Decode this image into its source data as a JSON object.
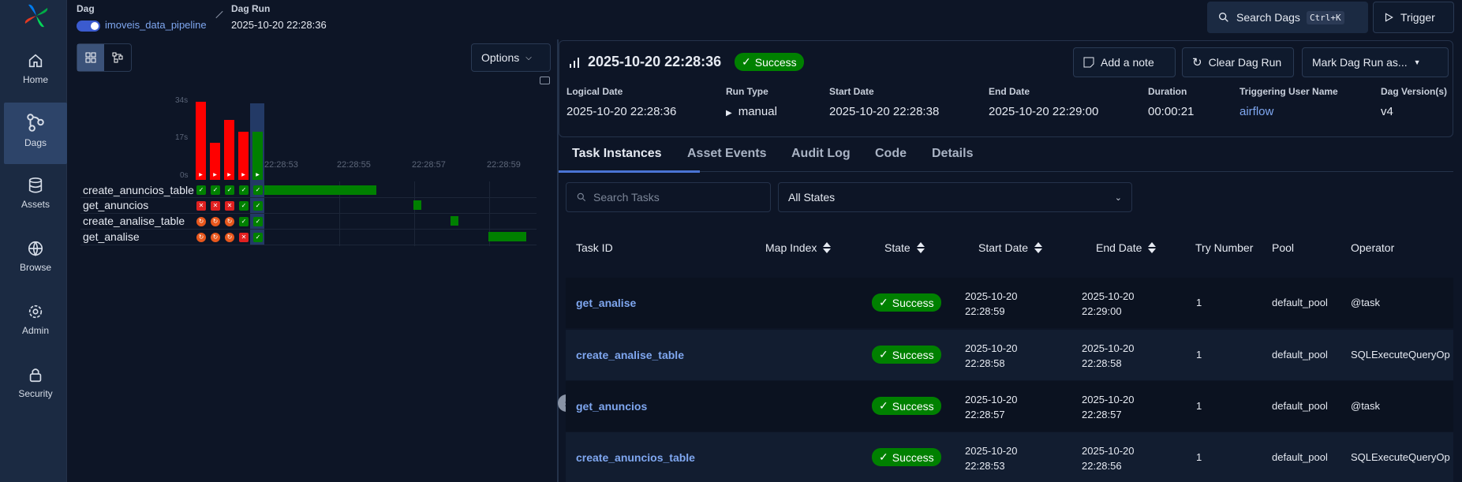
{
  "sidebar": {
    "items": [
      {
        "label": "Home",
        "icon": "home-icon"
      },
      {
        "label": "Dags",
        "icon": "dags-icon",
        "active": true
      },
      {
        "label": "Assets",
        "icon": "database-icon"
      },
      {
        "label": "Browse",
        "icon": "globe-icon"
      },
      {
        "label": "Admin",
        "icon": "gear-icon"
      },
      {
        "label": "Security",
        "icon": "lock-icon"
      }
    ]
  },
  "header": {
    "dag_label": "Dag",
    "dag_name": "imoveis_data_pipeline",
    "dagrun_label": "Dag Run",
    "dagrun_value": "2025-10-20 22:28:36",
    "search_label": "Search Dags",
    "search_kbd": "Ctrl+K",
    "trigger_label": "Trigger"
  },
  "graph": {
    "options_label": "Options",
    "y_ticks": [
      "34s",
      "17s",
      "0s"
    ],
    "time_ticks": [
      "22:28:53",
      "22:28:55",
      "22:28:57",
      "22:28:59"
    ],
    "durations_s": [
      34,
      16,
      26,
      21,
      21
    ],
    "tasks": [
      "create_anuncios_table",
      "get_anuncios",
      "create_analise_table",
      "get_analise"
    ],
    "colors": {
      "success": "#008000",
      "failed": "#ff0000",
      "upstream_failed": "#e8571c"
    }
  },
  "run": {
    "title": "2025-10-20 22:28:36",
    "status": "Success",
    "add_note": "Add a note",
    "clear": "Clear Dag Run",
    "mark": "Mark Dag Run as...",
    "meta": [
      {
        "key": "Logical Date",
        "value": "2025-10-20 22:28:36"
      },
      {
        "key": "Run Type",
        "value": "manual"
      },
      {
        "key": "Start Date",
        "value": "2025-10-20 22:28:38"
      },
      {
        "key": "End Date",
        "value": "2025-10-20 22:29:00"
      },
      {
        "key": "Duration",
        "value": "00:00:21"
      },
      {
        "key": "Triggering User Name",
        "value": "airflow"
      },
      {
        "key": "Dag Version(s)",
        "value": "v4"
      }
    ]
  },
  "tabs": [
    "Task Instances",
    "Asset Events",
    "Audit Log",
    "Code",
    "Details"
  ],
  "filters": {
    "search_placeholder": "Search Tasks",
    "state_value": "All States"
  },
  "table": {
    "headers": [
      "Task ID",
      "Map Index",
      "State",
      "Start Date",
      "End Date",
      "Try Number",
      "Pool",
      "Operator"
    ],
    "rows": [
      {
        "task_id": "get_analise",
        "state": "Success",
        "start_d": "2025-10-20",
        "start_t": "22:28:59",
        "end_d": "2025-10-20",
        "end_t": "22:29:00",
        "try": "1",
        "pool": "default_pool",
        "operator": "@task"
      },
      {
        "task_id": "create_analise_table",
        "state": "Success",
        "start_d": "2025-10-20",
        "start_t": "22:28:58",
        "end_d": "2025-10-20",
        "end_t": "22:28:58",
        "try": "1",
        "pool": "default_pool",
        "operator": "SQLExecuteQueryOp"
      },
      {
        "task_id": "get_anuncios",
        "state": "Success",
        "start_d": "2025-10-20",
        "start_t": "22:28:57",
        "end_d": "2025-10-20",
        "end_t": "22:28:57",
        "try": "1",
        "pool": "default_pool",
        "operator": "@task"
      },
      {
        "task_id": "create_anuncios_table",
        "state": "Success",
        "start_d": "2025-10-20",
        "start_t": "22:28:53",
        "end_d": "2025-10-20",
        "end_t": "22:28:56",
        "try": "1",
        "pool": "default_pool",
        "operator": "SQLExecuteQueryOp"
      }
    ]
  }
}
